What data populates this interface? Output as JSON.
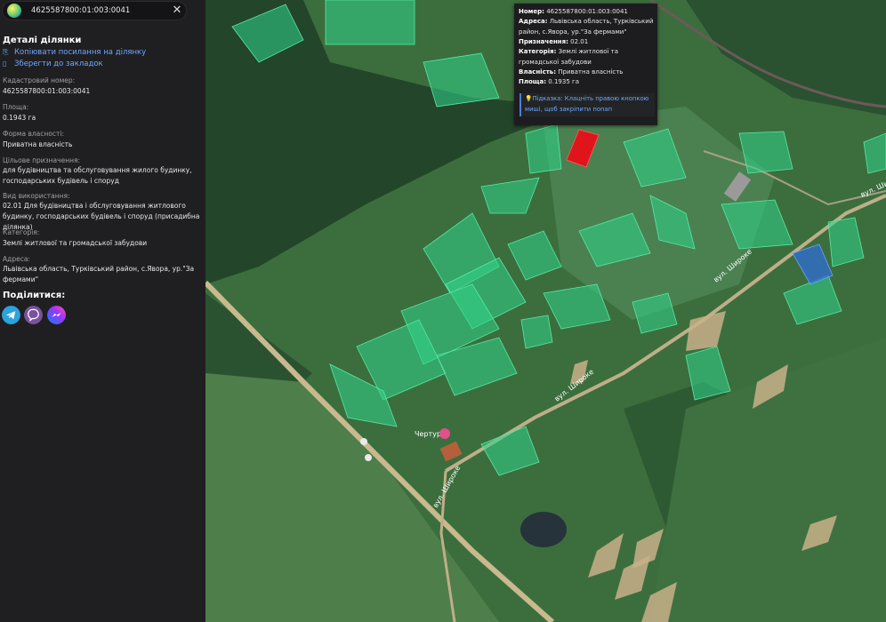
{
  "search": {
    "value": "4625587800:01:003:0041"
  },
  "sidebar": {
    "title": "Деталі ділянки",
    "copy_link": "Копіювати посилання на ділянку",
    "bookmark": "Зберегти до закладок",
    "fields": [
      {
        "label": "Кадастровий номер:",
        "value": "4625587800:01:003:0041"
      },
      {
        "label": "Площа:",
        "value": "0.1943 га"
      },
      {
        "label": "Форма власності:",
        "value": "Приватна власність"
      },
      {
        "label": "Цільове призначення:",
        "value": "для будівництва та обслуговування жилого будинку, господарських будівель і споруд"
      },
      {
        "label": "Вид використання:",
        "value": "02.01 Для будівництва і обслуговування житлового будинку, господарських будівель і споруд (присадибна ділянка)"
      },
      {
        "label": "Категорія:",
        "value": "Землі житлової та громадської забудови"
      },
      {
        "label": "Адреса:",
        "value": "Львівська область, Турківський район, с.Явора, ур.\"За фермами\""
      }
    ],
    "share_title": "Поділитися:",
    "share_icons": [
      "telegram-icon",
      "viber-icon",
      "messenger-icon"
    ]
  },
  "popup": {
    "number_label": "Номер:",
    "number": "4625587800:01:003:0041",
    "address_label": "Адреса:",
    "address": "Львівська область, Турківський район, с.Явора, ур.\"За фермами\"",
    "purpose_label": "Призначення:",
    "purpose": "02.01",
    "category_label": "Категорія:",
    "category": "Землі житлової та громадської забудови",
    "ownership_label": "Власність:",
    "ownership": "Приватна власність",
    "area_label": "Площа:",
    "area": "0.1935 га",
    "hint_label": "Підказка:",
    "hint": "Клацніть правою кнопкою миші, щоб закріпити попап"
  },
  "map": {
    "streets": [
      "вул. Широке",
      "вул. Широке",
      "вул. Широке",
      "вул. Широке"
    ],
    "poi": "Чертур",
    "colors": {
      "selected": "#e0141b",
      "parcel": "#2fd68a",
      "alt_parcel": "#2f6fd6",
      "background": "#2c5a33"
    }
  }
}
